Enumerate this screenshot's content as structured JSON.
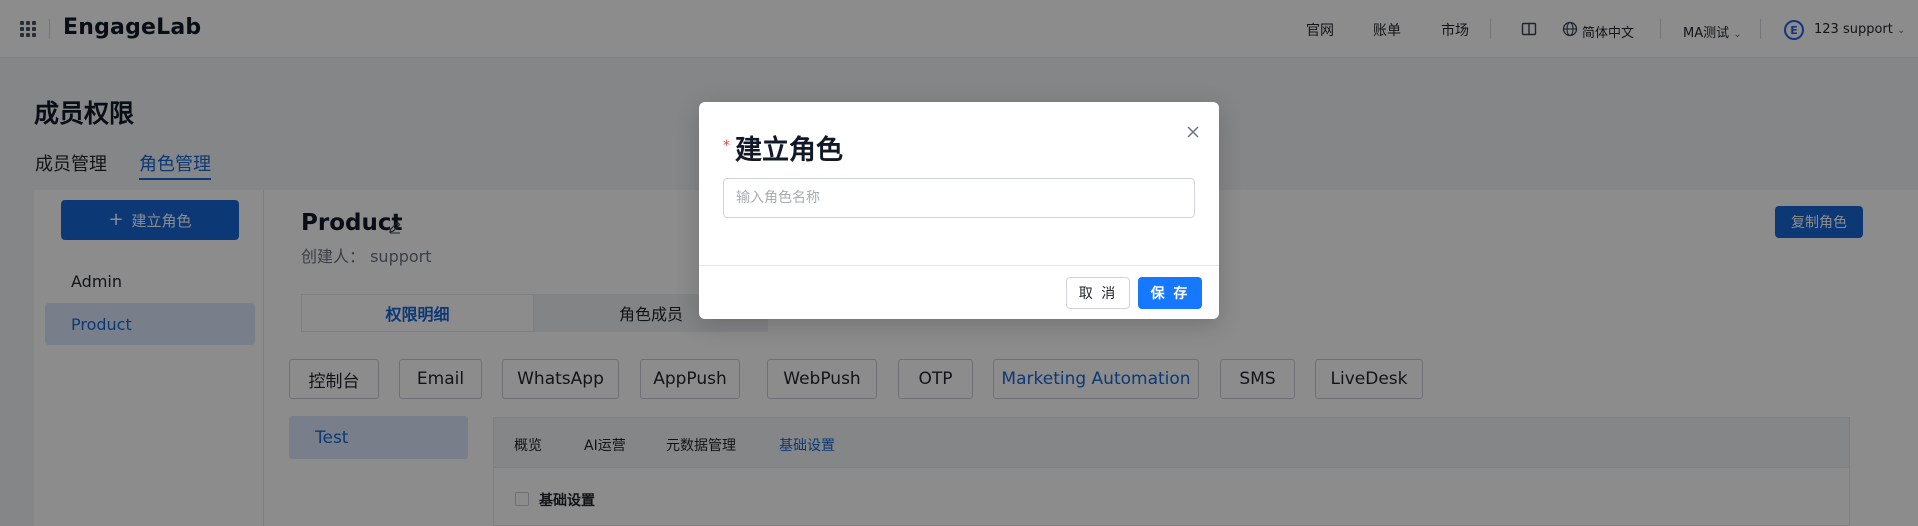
{
  "colors": {
    "primary": "#1766d6",
    "save_button": "#1677ff",
    "required_star": "#e5484d",
    "overlay": "rgba(0,0,0,0.45)"
  },
  "header": {
    "apps_icon": "grid-icon",
    "logo": "EngageLab",
    "links": [
      "官网",
      "账单",
      "市场"
    ],
    "layout_icon": "book-icon",
    "language": "简体中文",
    "language_icon": "globe-icon",
    "workspace": "MA测试",
    "avatar_letter": "E",
    "user": "123 support"
  },
  "page": {
    "title": "成员权限",
    "tabs": [
      "成员管理",
      "角色管理"
    ],
    "active_tab": "角色管理"
  },
  "sidebar": {
    "create_button": "建立角色",
    "create_icon": "plus-icon",
    "roles": [
      "Admin",
      "Product"
    ],
    "selected": "Product"
  },
  "role_detail": {
    "name": "Product",
    "edit_icon": "pencil-icon",
    "creator": "创建人：  support",
    "copy_button": "复制角色",
    "segments": [
      "权限明细",
      "角色成员"
    ],
    "products": [
      "控制台",
      "Email",
      "WhatsApp",
      "AppPush",
      "WebPush",
      "OTP",
      "Marketing Automation",
      "SMS",
      "LiveDesk"
    ],
    "active_product": "Marketing Automation",
    "flows": [
      "Test"
    ],
    "detail_tabs": [
      "概览",
      "AI运营",
      "元数据管理",
      "基础设置"
    ],
    "active_detail_tab": "基础设置",
    "checkbox_label": "基础设置"
  },
  "modal": {
    "required_mark": "*",
    "title": "建立角色",
    "input_placeholder": "输入角色名称",
    "input_value": "",
    "cancel": "取 消",
    "save": "保 存",
    "close_icon": "close-icon"
  }
}
